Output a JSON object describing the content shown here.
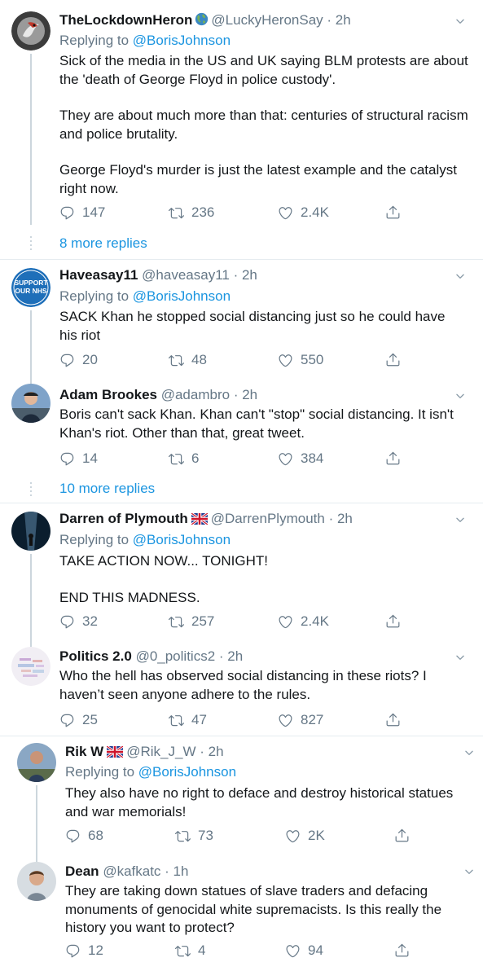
{
  "colors": {
    "link": "#1b95e0",
    "muted": "#657786",
    "text": "#14171a",
    "line": "#e6ecf0"
  },
  "tweets": [
    {
      "name": "TheLockdownHeron",
      "badge": "globe-emoji",
      "handle": "@LuckyHeronSay",
      "time": "· 2h",
      "reply_prefix": "Replying to ",
      "reply_to": "@BorisJohnson",
      "paragraphs": [
        "Sick of the media in the US and UK saying BLM protests are about the 'death of George Floyd in police custody'.",
        "They are about much more than that: centuries of structural racism and police brutality.",
        "George Floyd's murder is just the latest example and the catalyst right now."
      ],
      "replies": "147",
      "retweets": "236",
      "likes": "2.4K"
    },
    {
      "name": "Haveasay11",
      "handle": "@haveasay11",
      "time": "· 2h",
      "avatar_text": [
        "SUPPORT",
        "OUR NHS"
      ],
      "reply_prefix": "Replying to ",
      "reply_to": "@BorisJohnson",
      "paragraphs": [
        "SACK Khan he stopped social distancing just so he could have his riot"
      ],
      "replies": "20",
      "retweets": "48",
      "likes": "550"
    },
    {
      "name": "Adam Brookes",
      "handle": "@adambro",
      "time": "· 2h",
      "paragraphs": [
        "Boris can't sack Khan. Khan can't \"stop\" social distancing. It isn't Khan's riot. Other than that, great tweet."
      ],
      "replies": "14",
      "retweets": "6",
      "likes": "384"
    },
    {
      "name": "Darren of Plymouth",
      "badge": "uk-flag-emoji",
      "handle": "@DarrenPlymouth",
      "time": "· 2h",
      "reply_prefix": "Replying to ",
      "reply_to": "@BorisJohnson",
      "paragraphs": [
        "TAKE ACTION NOW... TONIGHT!",
        "END THIS MADNESS."
      ],
      "replies": "32",
      "retweets": "257",
      "likes": "2.4K"
    },
    {
      "name": "Politics 2.0",
      "handle": "@0_politics2",
      "time": "· 2h",
      "paragraphs": [
        "Who the hell has observed social distancing in these riots? I haven’t seen anyone adhere to the rules."
      ],
      "replies": "25",
      "retweets": "47",
      "likes": "827"
    },
    {
      "name": "Rik W",
      "badge": "uk-flag-emoji",
      "handle": "@Rik_J_W",
      "time": "· 2h",
      "reply_prefix": "Replying to ",
      "reply_to": "@BorisJohnson",
      "paragraphs": [
        "They also have no right to deface and destroy historical statues and war memorials!"
      ],
      "replies": "68",
      "retweets": "73",
      "likes": "2K"
    },
    {
      "name": "Dean",
      "handle": "@kafkatc",
      "time": "· 1h",
      "paragraphs": [
        "They are taking down statues of slave traders and defacing monuments of genocidal white supremacists. Is this really the history you want to protect?"
      ],
      "replies": "12",
      "retweets": "4",
      "likes": "94"
    }
  ],
  "more_replies": [
    "8 more replies",
    "10 more replies"
  ]
}
